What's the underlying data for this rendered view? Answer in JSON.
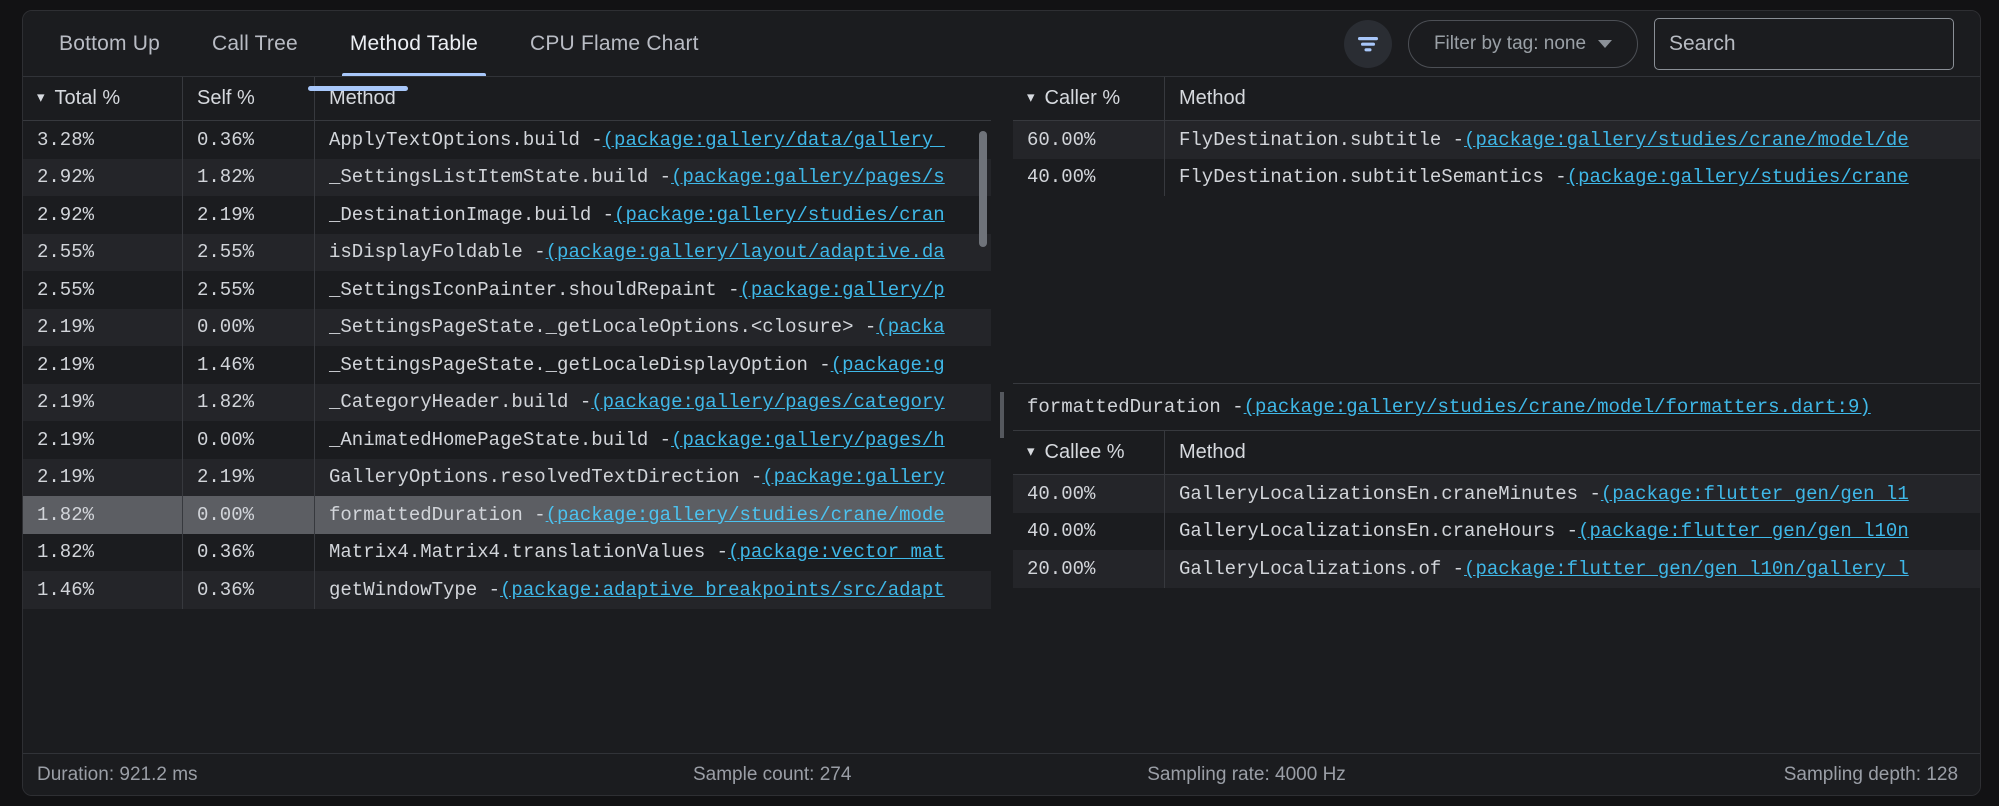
{
  "tabs": [
    {
      "label": "Bottom Up",
      "active": false
    },
    {
      "label": "Call Tree",
      "active": false
    },
    {
      "label": "Method Table",
      "active": true
    },
    {
      "label": "CPU Flame Chart",
      "active": false
    }
  ],
  "toolbar": {
    "filter_icon": "filter-icon",
    "tag_filter_label": "Filter by tag: none",
    "search_placeholder": "Search"
  },
  "method_table": {
    "columns": [
      "Total %",
      "Self %",
      "Method"
    ],
    "sorted_column": "Total %",
    "rows": [
      {
        "total": "3.28%",
        "self": "0.36%",
        "method": "ApplyTextOptions.build - ",
        "link": "(package:gallery/data/gallery_"
      },
      {
        "total": "2.92%",
        "self": "1.82%",
        "method": "_SettingsListItemState.build - ",
        "link": "(package:gallery/pages/s"
      },
      {
        "total": "2.92%",
        "self": "2.19%",
        "method": "_DestinationImage.build - ",
        "link": "(package:gallery/studies/cran"
      },
      {
        "total": "2.55%",
        "self": "2.55%",
        "method": "isDisplayFoldable - ",
        "link": "(package:gallery/layout/adaptive.da"
      },
      {
        "total": "2.55%",
        "self": "2.55%",
        "method": "_SettingsIconPainter.shouldRepaint - ",
        "link": "(package:gallery/p"
      },
      {
        "total": "2.19%",
        "self": "0.00%",
        "method": "_SettingsPageState._getLocaleOptions.<closure> - ",
        "link": "(packa"
      },
      {
        "total": "2.19%",
        "self": "1.46%",
        "method": "_SettingsPageState._getLocaleDisplayOption - ",
        "link": "(package:g"
      },
      {
        "total": "2.19%",
        "self": "1.82%",
        "method": "_CategoryHeader.build - ",
        "link": "(package:gallery/pages/category"
      },
      {
        "total": "2.19%",
        "self": "0.00%",
        "method": "_AnimatedHomePageState.build - ",
        "link": "(package:gallery/pages/h"
      },
      {
        "total": "2.19%",
        "self": "2.19%",
        "method": "GalleryOptions.resolvedTextDirection - ",
        "link": "(package:gallery"
      },
      {
        "total": "1.82%",
        "self": "0.00%",
        "method": "formattedDuration - ",
        "link": "(package:gallery/studies/crane/mode",
        "selected": true
      },
      {
        "total": "1.82%",
        "self": "0.36%",
        "method": "Matrix4.Matrix4.translationValues - ",
        "link": "(package:vector_mat"
      },
      {
        "total": "1.46%",
        "self": "0.36%",
        "method": "getWindowType - ",
        "link": "(package:adaptive_breakpoints/src/adapt"
      }
    ]
  },
  "caller_table": {
    "columns": [
      "Caller %",
      "Method"
    ],
    "sorted_column": "Caller %",
    "rows": [
      {
        "pct": "60.00%",
        "method": "FlyDestination.subtitle - ",
        "link": "(package:gallery/studies/crane/model/de"
      },
      {
        "pct": "40.00%",
        "method": "FlyDestination.subtitleSemantics - ",
        "link": "(package:gallery/studies/crane"
      }
    ]
  },
  "selected_method": {
    "name": "formattedDuration - ",
    "link": "(package:gallery/studies/crane/model/formatters.dart:9)"
  },
  "callee_table": {
    "columns": [
      "Callee %",
      "Method"
    ],
    "sorted_column": "Callee %",
    "rows": [
      {
        "pct": "40.00%",
        "method": "GalleryLocalizationsEn.craneMinutes - ",
        "link": "(package:flutter_gen/gen_l1"
      },
      {
        "pct": "40.00%",
        "method": "GalleryLocalizationsEn.craneHours - ",
        "link": "(package:flutter_gen/gen_l10n"
      },
      {
        "pct": "20.00%",
        "method": "GalleryLocalizations.of - ",
        "link": "(package:flutter_gen/gen_l10n/gallery_l"
      }
    ]
  },
  "status": {
    "duration": "Duration: 921.2 ms",
    "sample_count": "Sample count: 274",
    "sampling_rate": "Sampling rate: 4000 Hz",
    "sampling_depth": "Sampling depth: 128"
  },
  "colors": {
    "accent": "#a8c7fa",
    "link": "#3fb8e8",
    "panel_bg": "#1b1c1f",
    "row_alt_bg": "#242529",
    "selected_row_bg": "#5c5e63"
  }
}
